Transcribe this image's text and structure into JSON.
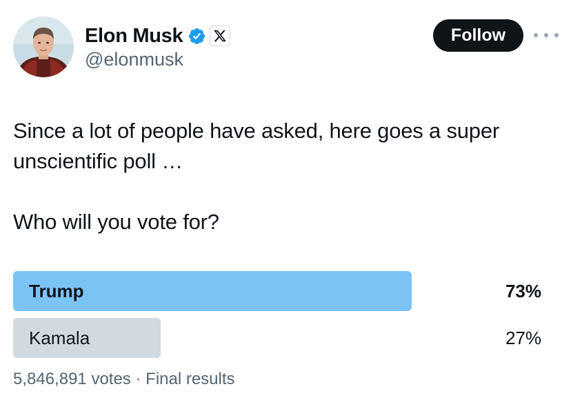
{
  "author": {
    "display_name": "Elon Musk",
    "handle": "@elonmusk",
    "verified_color": "#1d9bf0"
  },
  "actions": {
    "follow_label": "Follow"
  },
  "tweet": {
    "text_line1": "Since a lot of people have asked, here goes a super unscientific poll …",
    "text_line2": "Who will you vote for?"
  },
  "poll": {
    "options": [
      {
        "label": "Trump",
        "percent": "73%",
        "fraction": 0.73,
        "bar_color": "#7cc3f5",
        "winner": true
      },
      {
        "label": "Kamala",
        "percent": "27%",
        "fraction": 0.27,
        "bar_color": "#d2dae0",
        "winner": false
      }
    ],
    "votes": "5,846,891 votes",
    "separator": "·",
    "status": "Final results"
  },
  "icons": {
    "verified": "verified-badge-icon",
    "affiliate": "x-logo-icon",
    "more": "more-options-icon"
  }
}
